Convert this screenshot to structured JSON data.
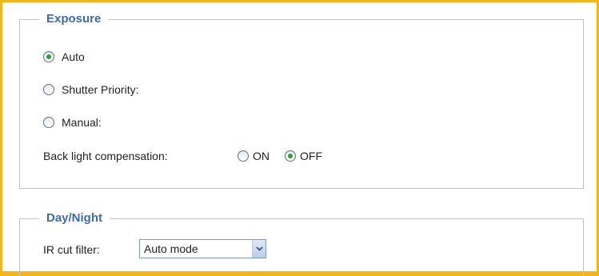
{
  "exposure": {
    "legend": "Exposure",
    "options": [
      {
        "label": "Auto",
        "checked": true
      },
      {
        "label": "Shutter Priority:",
        "checked": false
      },
      {
        "label": "Manual:",
        "checked": false
      }
    ],
    "backlight": {
      "label": "Back light compensation:",
      "on_label": "ON",
      "off_label": "OFF",
      "selected": "OFF"
    }
  },
  "daynight": {
    "legend": "Day/Night",
    "ir_label": "IR cut filter:",
    "ir_value": "Auto mode"
  },
  "colors": {
    "frame": "#f3b51a",
    "legend": "#3c6cab",
    "radio_check": "#2e9e2e"
  },
  "icons": {
    "dropdown": "chevron-down-icon"
  }
}
